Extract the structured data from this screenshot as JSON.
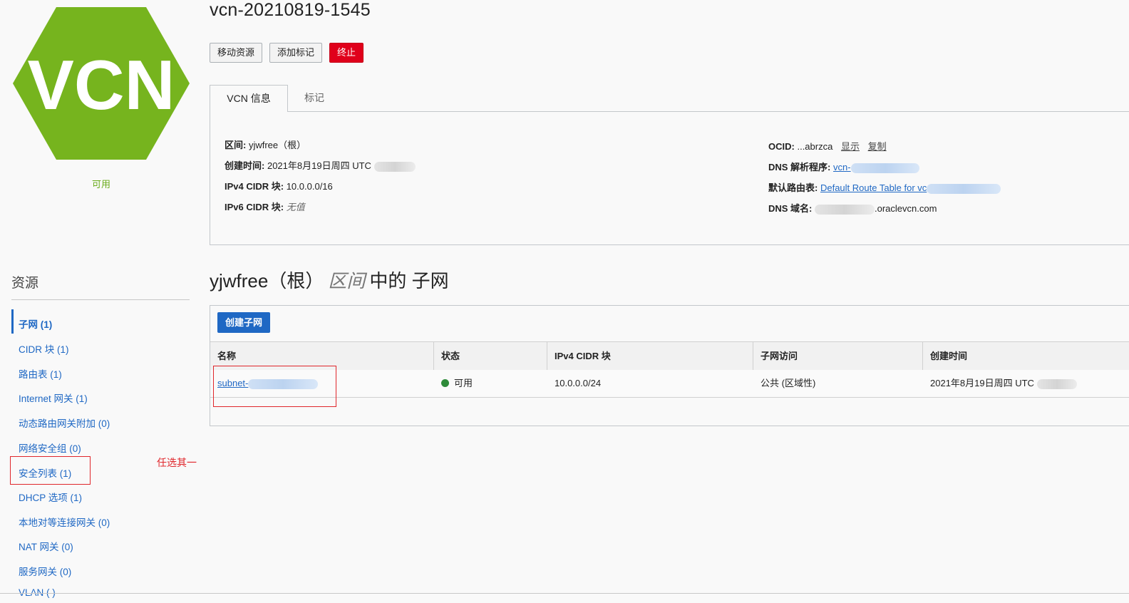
{
  "resource": {
    "logo_text": "VCN",
    "status": "可用",
    "name": "vcn-20210819-1545"
  },
  "actions": {
    "move": "移动资源",
    "add_tag": "添加标记",
    "terminate": "终止"
  },
  "tabs": [
    {
      "label": "VCN 信息",
      "active": true
    },
    {
      "label": "标记",
      "active": false
    }
  ],
  "info": {
    "compartment_label": "区间:",
    "compartment_value": "yjwfree（根）",
    "created_label": "创建时间:",
    "created_value": "2021年8月19日周四 UTC",
    "ipv4_label": "IPv4 CIDR 块:",
    "ipv4_value": "10.0.0.0/16",
    "ipv6_label": "IPv6 CIDR 块:",
    "ipv6_value": "无值",
    "ocid_label": "OCID:",
    "ocid_value": "...abrzca",
    "ocid_show": "显示",
    "ocid_copy": "复制",
    "dns_resolver_label": "DNS 解析程序:",
    "dns_resolver_value": "vcn-",
    "route_table_label": "默认路由表:",
    "route_table_value": "Default Route Table for vc",
    "dns_domain_label": "DNS 域名:",
    "dns_domain_value": ".oraclevcn.com"
  },
  "sidebar": {
    "heading": "资源",
    "items": [
      {
        "label": "子网 (1)",
        "active": true
      },
      {
        "label": "CIDR 块 (1)"
      },
      {
        "label": "路由表 (1)"
      },
      {
        "label": "Internet 网关 (1)"
      },
      {
        "label": "动态路由网关附加 (0)"
      },
      {
        "label": "网络安全组 (0)"
      },
      {
        "label": "安全列表 (1)"
      },
      {
        "label": "DHCP 选项 (1)"
      },
      {
        "label": "本地对等连接网关 (0)"
      },
      {
        "label": "NAT 网关 (0)"
      },
      {
        "label": "服务网关 (0)"
      },
      {
        "label": "VLAN ( )"
      }
    ],
    "annotation": "任选其一"
  },
  "subnets": {
    "title_compartment": "yjwfree（根）",
    "title_italic": "区间",
    "title_rest": "中的 子网",
    "create_button": "创建子网",
    "columns": [
      "名称",
      "状态",
      "IPv4 CIDR 块",
      "子网访问",
      "创建时间"
    ],
    "rows": [
      {
        "name": "subnet-",
        "status": "可用",
        "cidr": "10.0.0.0/24",
        "access": "公共 (区域性)",
        "created": "2021年8月19日周四 UTC"
      }
    ]
  },
  "colors": {
    "logo_green": "#76b41e",
    "status_green": "#6aab1c",
    "link_blue": "#1f68c4",
    "danger_red": "#e0001b",
    "annotation_red": "#e0262b"
  }
}
